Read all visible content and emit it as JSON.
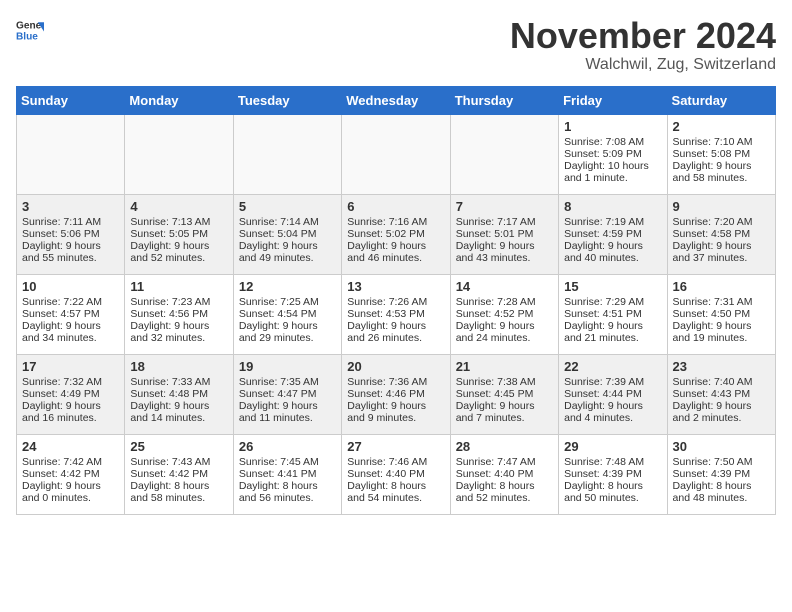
{
  "header": {
    "logo_line1": "General",
    "logo_line2": "Blue",
    "title": "November 2024",
    "subtitle": "Walchwil, Zug, Switzerland"
  },
  "weekdays": [
    "Sunday",
    "Monday",
    "Tuesday",
    "Wednesday",
    "Thursday",
    "Friday",
    "Saturday"
  ],
  "weeks": [
    [
      {
        "day": "",
        "info": ""
      },
      {
        "day": "",
        "info": ""
      },
      {
        "day": "",
        "info": ""
      },
      {
        "day": "",
        "info": ""
      },
      {
        "day": "",
        "info": ""
      },
      {
        "day": "1",
        "info": "Sunrise: 7:08 AM\nSunset: 5:09 PM\nDaylight: 10 hours and 1 minute."
      },
      {
        "day": "2",
        "info": "Sunrise: 7:10 AM\nSunset: 5:08 PM\nDaylight: 9 hours and 58 minutes."
      }
    ],
    [
      {
        "day": "3",
        "info": "Sunrise: 7:11 AM\nSunset: 5:06 PM\nDaylight: 9 hours and 55 minutes."
      },
      {
        "day": "4",
        "info": "Sunrise: 7:13 AM\nSunset: 5:05 PM\nDaylight: 9 hours and 52 minutes."
      },
      {
        "day": "5",
        "info": "Sunrise: 7:14 AM\nSunset: 5:04 PM\nDaylight: 9 hours and 49 minutes."
      },
      {
        "day": "6",
        "info": "Sunrise: 7:16 AM\nSunset: 5:02 PM\nDaylight: 9 hours and 46 minutes."
      },
      {
        "day": "7",
        "info": "Sunrise: 7:17 AM\nSunset: 5:01 PM\nDaylight: 9 hours and 43 minutes."
      },
      {
        "day": "8",
        "info": "Sunrise: 7:19 AM\nSunset: 4:59 PM\nDaylight: 9 hours and 40 minutes."
      },
      {
        "day": "9",
        "info": "Sunrise: 7:20 AM\nSunset: 4:58 PM\nDaylight: 9 hours and 37 minutes."
      }
    ],
    [
      {
        "day": "10",
        "info": "Sunrise: 7:22 AM\nSunset: 4:57 PM\nDaylight: 9 hours and 34 minutes."
      },
      {
        "day": "11",
        "info": "Sunrise: 7:23 AM\nSunset: 4:56 PM\nDaylight: 9 hours and 32 minutes."
      },
      {
        "day": "12",
        "info": "Sunrise: 7:25 AM\nSunset: 4:54 PM\nDaylight: 9 hours and 29 minutes."
      },
      {
        "day": "13",
        "info": "Sunrise: 7:26 AM\nSunset: 4:53 PM\nDaylight: 9 hours and 26 minutes."
      },
      {
        "day": "14",
        "info": "Sunrise: 7:28 AM\nSunset: 4:52 PM\nDaylight: 9 hours and 24 minutes."
      },
      {
        "day": "15",
        "info": "Sunrise: 7:29 AM\nSunset: 4:51 PM\nDaylight: 9 hours and 21 minutes."
      },
      {
        "day": "16",
        "info": "Sunrise: 7:31 AM\nSunset: 4:50 PM\nDaylight: 9 hours and 19 minutes."
      }
    ],
    [
      {
        "day": "17",
        "info": "Sunrise: 7:32 AM\nSunset: 4:49 PM\nDaylight: 9 hours and 16 minutes."
      },
      {
        "day": "18",
        "info": "Sunrise: 7:33 AM\nSunset: 4:48 PM\nDaylight: 9 hours and 14 minutes."
      },
      {
        "day": "19",
        "info": "Sunrise: 7:35 AM\nSunset: 4:47 PM\nDaylight: 9 hours and 11 minutes."
      },
      {
        "day": "20",
        "info": "Sunrise: 7:36 AM\nSunset: 4:46 PM\nDaylight: 9 hours and 9 minutes."
      },
      {
        "day": "21",
        "info": "Sunrise: 7:38 AM\nSunset: 4:45 PM\nDaylight: 9 hours and 7 minutes."
      },
      {
        "day": "22",
        "info": "Sunrise: 7:39 AM\nSunset: 4:44 PM\nDaylight: 9 hours and 4 minutes."
      },
      {
        "day": "23",
        "info": "Sunrise: 7:40 AM\nSunset: 4:43 PM\nDaylight: 9 hours and 2 minutes."
      }
    ],
    [
      {
        "day": "24",
        "info": "Sunrise: 7:42 AM\nSunset: 4:42 PM\nDaylight: 9 hours and 0 minutes."
      },
      {
        "day": "25",
        "info": "Sunrise: 7:43 AM\nSunset: 4:42 PM\nDaylight: 8 hours and 58 minutes."
      },
      {
        "day": "26",
        "info": "Sunrise: 7:45 AM\nSunset: 4:41 PM\nDaylight: 8 hours and 56 minutes."
      },
      {
        "day": "27",
        "info": "Sunrise: 7:46 AM\nSunset: 4:40 PM\nDaylight: 8 hours and 54 minutes."
      },
      {
        "day": "28",
        "info": "Sunrise: 7:47 AM\nSunset: 4:40 PM\nDaylight: 8 hours and 52 minutes."
      },
      {
        "day": "29",
        "info": "Sunrise: 7:48 AM\nSunset: 4:39 PM\nDaylight: 8 hours and 50 minutes."
      },
      {
        "day": "30",
        "info": "Sunrise: 7:50 AM\nSunset: 4:39 PM\nDaylight: 8 hours and 48 minutes."
      }
    ]
  ]
}
